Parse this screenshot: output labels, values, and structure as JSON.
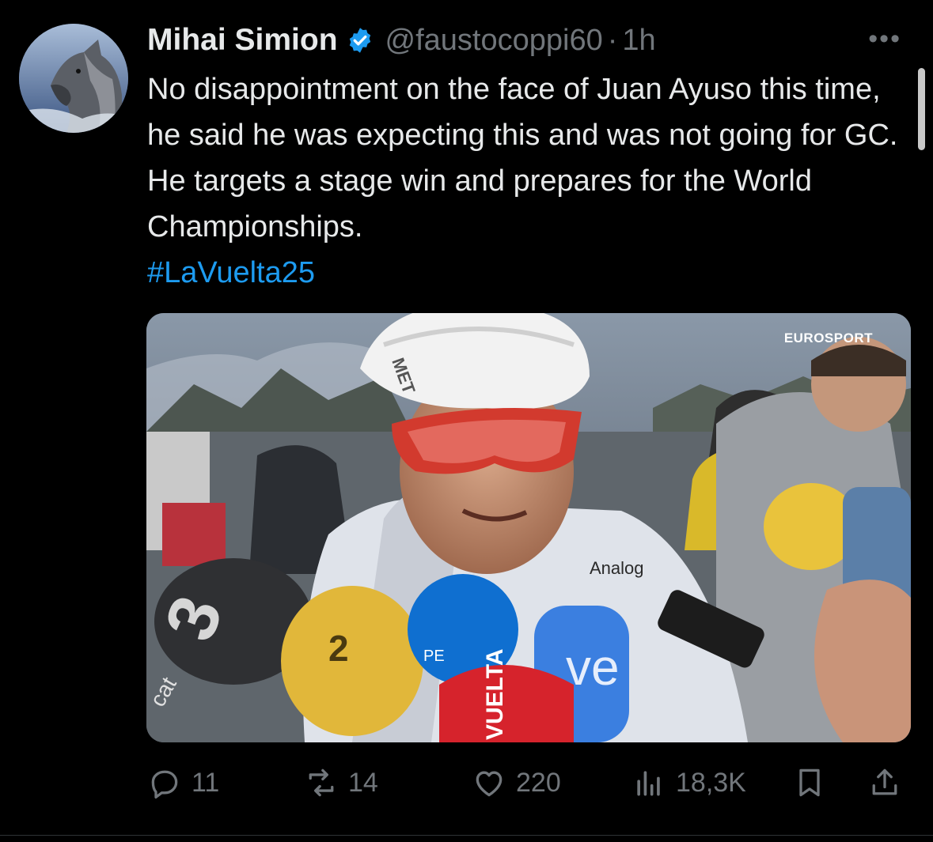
{
  "post": {
    "author_name": "Mihai Simion",
    "author_handle": "@faustocoppi60",
    "separator": "·",
    "time": "1h",
    "more_label": "•••",
    "text": "No disappointment on the face of Juan Ayuso this time, he said he was expecting this and was not going for GC. He targets a stage win and prepares for the World Championships.",
    "hashtag": "#LaVuelta25",
    "media": {
      "watermark": "EUROSPORT",
      "labels": [
        "MET",
        "Analog",
        "VUELTA",
        "ve",
        "3",
        "cat",
        "2",
        "PE"
      ]
    },
    "metrics": {
      "replies": "11",
      "reposts": "14",
      "likes": "220",
      "views": "18,3K"
    }
  },
  "icons": [
    "verified-badge-icon",
    "reply-icon",
    "repost-icon",
    "like-icon",
    "views-icon",
    "bookmark-icon",
    "share-icon"
  ],
  "colors": {
    "background": "#000000",
    "text": "#e7e9ea",
    "muted": "#71767b",
    "link": "#1d9bf0",
    "verified": "#1d9bf0"
  }
}
